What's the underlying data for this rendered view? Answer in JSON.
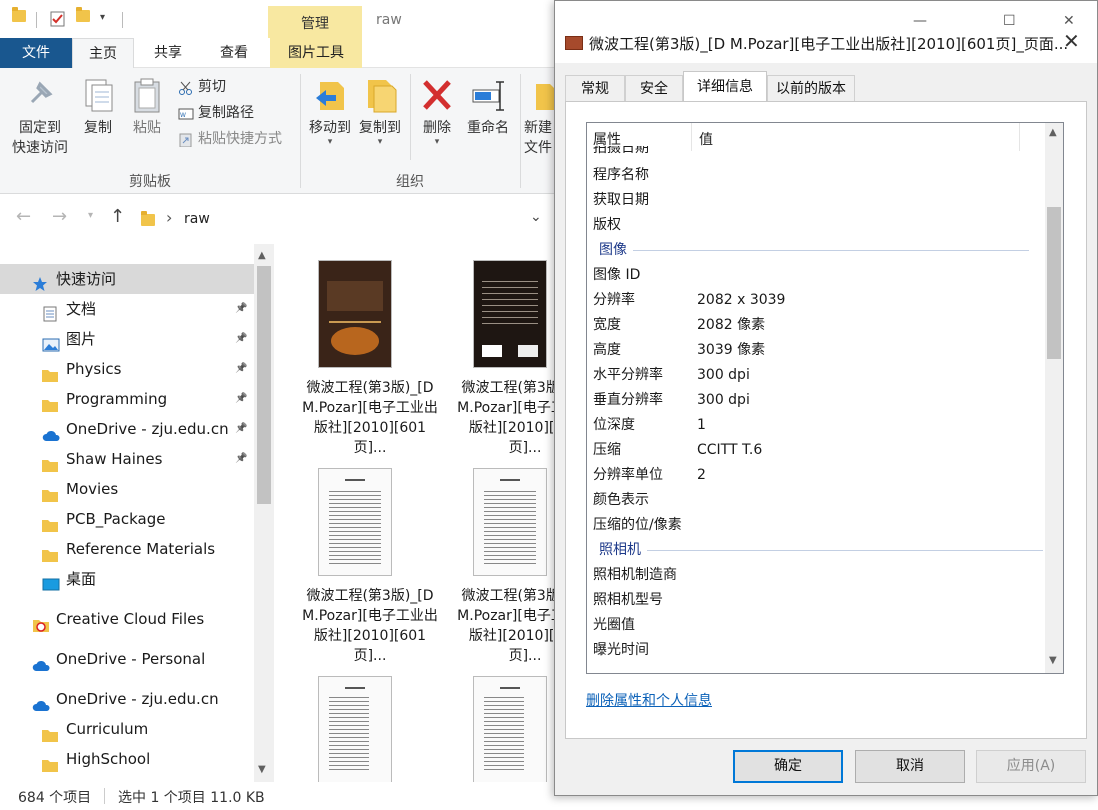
{
  "explorer": {
    "title": "raw",
    "contextual_tab": "管理",
    "tabs": [
      "文件",
      "主页",
      "共享",
      "查看",
      "图片工具"
    ],
    "ribbon": {
      "pin_label": [
        "固定到",
        "快速访问"
      ],
      "copy": "复制",
      "paste": "粘贴",
      "cut": "剪切",
      "copy_path": "复制路径",
      "paste_shortcut": "粘贴快捷方式",
      "clipboard_group": "剪贴板",
      "move_to": "移动到",
      "copy_to": "复制到",
      "delete": "删除",
      "rename": "重命名",
      "organize_group": "组织",
      "new_label": [
        "新建",
        "文件"
      ]
    },
    "address": {
      "path": "raw"
    },
    "nav": [
      {
        "label": "快速访问",
        "icon": "star-icon",
        "pinned": false
      },
      {
        "label": "文档",
        "icon": "document-icon",
        "pinned": true
      },
      {
        "label": "图片",
        "icon": "picture-icon",
        "pinned": true
      },
      {
        "label": "Physics",
        "icon": "folder-icon",
        "pinned": true
      },
      {
        "label": "Programming",
        "icon": "folder-icon",
        "pinned": true
      },
      {
        "label": "OneDrive - zju.edu.cn",
        "icon": "cloud-icon",
        "pinned": true
      },
      {
        "label": "Shaw Haines",
        "icon": "folder-icon",
        "pinned": true
      },
      {
        "label": "Movies",
        "icon": "folder-icon",
        "pinned": false
      },
      {
        "label": "PCB_Package",
        "icon": "folder-icon",
        "pinned": false
      },
      {
        "label": "Reference Materials",
        "icon": "folder-icon",
        "pinned": false
      },
      {
        "label": "桌面",
        "icon": "desktop-icon",
        "pinned": false
      },
      {
        "label": "Creative Cloud Files",
        "icon": "creative-cloud-icon",
        "pinned": false
      },
      {
        "label": "OneDrive - Personal",
        "icon": "cloud-icon",
        "pinned": false
      },
      {
        "label": "OneDrive - zju.edu.cn",
        "icon": "cloud-icon",
        "pinned": false
      },
      {
        "label": "Curriculum",
        "icon": "folder-icon",
        "pinned": false
      },
      {
        "label": "HighSchool",
        "icon": "folder-icon",
        "pinned": false
      }
    ],
    "files": [
      {
        "name": "微波工程(第3版)_[D M.Pozar][电子工业出版社][2010][601页]...",
        "thumb": "book-cover"
      },
      {
        "name": "微波工程(第3版)_[D M.Pozar][电子工业出版社][2010][601页]...",
        "thumb": "book-back"
      },
      {
        "name": "微波工程(第3版)_[D M.Pozar][电子工业出版社][2010][601页]...",
        "thumb": "text-page"
      },
      {
        "name": "微波工程(第3版)_[D M.Pozar][电子工业出版社][2010][601页]...",
        "thumb": "text-page"
      },
      {
        "name": "",
        "thumb": "toc-page"
      },
      {
        "name": "",
        "thumb": "toc-page"
      }
    ],
    "status": {
      "count": "684 个项目",
      "selection": "选中 1 个项目 11.0 KB"
    }
  },
  "dialog": {
    "title": "微波工程(第3版)_[D M.Pozar][电子工业出版社][2010][601页]_页面...",
    "tabs": [
      "常规",
      "安全",
      "详细信息",
      "以前的版本"
    ],
    "active_tab": "详细信息",
    "columns": {
      "property": "属性",
      "value": "值"
    },
    "rows_before": [
      {
        "k": "程序名称",
        "v": ""
      },
      {
        "k": "获取日期",
        "v": ""
      },
      {
        "k": "版权",
        "v": ""
      }
    ],
    "clipped_row": "拍摄日期",
    "section_image": "图像",
    "rows_image": [
      {
        "k": "图像 ID",
        "v": ""
      },
      {
        "k": "分辨率",
        "v": "2082 x 3039"
      },
      {
        "k": "宽度",
        "v": "2082 像素"
      },
      {
        "k": "高度",
        "v": "3039 像素"
      },
      {
        "k": "水平分辨率",
        "v": "300 dpi"
      },
      {
        "k": "垂直分辨率",
        "v": "300 dpi"
      },
      {
        "k": "位深度",
        "v": "1"
      },
      {
        "k": "压缩",
        "v": "CCITT T.6"
      },
      {
        "k": "分辨率单位",
        "v": "2"
      },
      {
        "k": "颜色表示",
        "v": ""
      },
      {
        "k": "压缩的位/像素",
        "v": ""
      }
    ],
    "section_camera": "照相机",
    "rows_camera": [
      {
        "k": "照相机制造商",
        "v": ""
      },
      {
        "k": "照相机型号",
        "v": ""
      },
      {
        "k": "光圈值",
        "v": ""
      },
      {
        "k": "曝光时间",
        "v": ""
      }
    ],
    "remove_link": "删除属性和个人信息",
    "buttons": {
      "ok": "确定",
      "cancel": "取消",
      "apply": "应用(A)"
    }
  },
  "colors": {
    "file_tab": "#19578f",
    "accent": "#0078d7",
    "link": "#0b61b8",
    "contextual": "#f8e8a1"
  }
}
